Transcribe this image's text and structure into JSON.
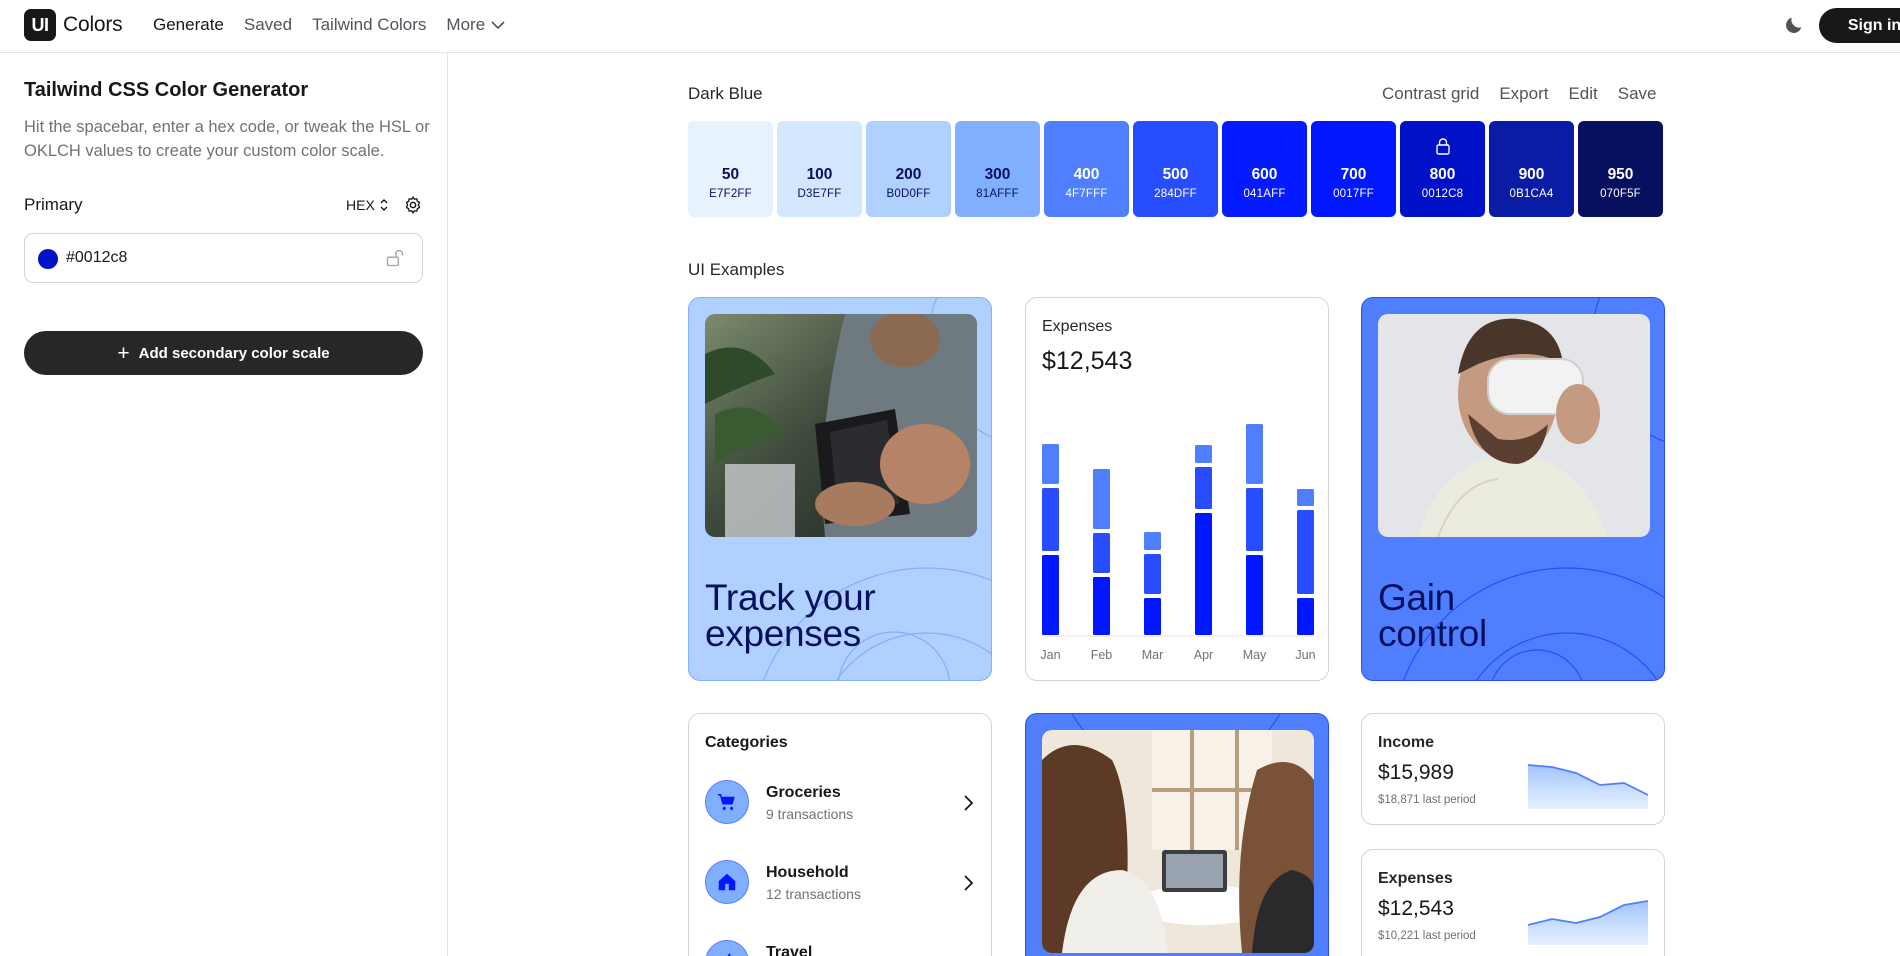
{
  "nav": {
    "logo_mark": "UI",
    "logo_text": "Colors",
    "links": [
      "Generate",
      "Saved",
      "Tailwind Colors"
    ],
    "more_label": "More",
    "signin_label": "Sign in"
  },
  "sidebar": {
    "title": "Tailwind CSS Color Generator",
    "description": "Hit the spacebar, enter a hex code, or tweak the HSL or OKLCH values to create your custom color scale.",
    "primary_label": "Primary",
    "format_label": "HEX",
    "input_value": "#0012c8",
    "input_color": "#0012c8",
    "add_button_label": "Add secondary color scale"
  },
  "palette": {
    "name": "Dark Blue",
    "actions": [
      "Contrast grid",
      "Export",
      "Edit",
      "Save"
    ],
    "locked_shade": "800",
    "swatches": [
      {
        "shade": "50",
        "hex": "E7F2FF",
        "color": "#e7f2ff",
        "text": "#070f5f"
      },
      {
        "shade": "100",
        "hex": "D3E7FF",
        "color": "#d3e7ff",
        "text": "#070f5f"
      },
      {
        "shade": "200",
        "hex": "B0D0FF",
        "color": "#b0d0ff",
        "text": "#070f5f"
      },
      {
        "shade": "300",
        "hex": "81AFFF",
        "color": "#81afff",
        "text": "#070f5f"
      },
      {
        "shade": "400",
        "hex": "4F7FFF",
        "color": "#4f7fff",
        "text": "#ffffff"
      },
      {
        "shade": "500",
        "hex": "284DFF",
        "color": "#284dff",
        "text": "#ffffff"
      },
      {
        "shade": "600",
        "hex": "041AFF",
        "color": "#041aff",
        "text": "#ffffff"
      },
      {
        "shade": "700",
        "hex": "0017FF",
        "color": "#0017ff",
        "text": "#ffffff"
      },
      {
        "shade": "800",
        "hex": "0012C8",
        "color": "#0012c8",
        "text": "#ffffff"
      },
      {
        "shade": "900",
        "hex": "0B1CA4",
        "color": "#0b1ca4",
        "text": "#ffffff"
      },
      {
        "shade": "950",
        "hex": "070F5F",
        "color": "#070f5f",
        "text": "#ffffff"
      }
    ]
  },
  "examples": {
    "heading": "UI Examples",
    "track_title_1": "Track your",
    "track_title_2": "expenses",
    "gain_title_1": "Gain",
    "gain_title_2": "control",
    "expenses_card": {
      "label": "Expenses",
      "amount": "$12,543"
    },
    "categories": {
      "title": "Categories",
      "items": [
        {
          "name": "Groceries",
          "sub": "9 transactions",
          "icon": "cart-icon"
        },
        {
          "name": "Household",
          "sub": "12 transactions",
          "icon": "home-icon"
        },
        {
          "name": "Travel",
          "sub": "",
          "icon": "plane-icon"
        }
      ]
    },
    "income_card": {
      "label": "Income",
      "amount": "$15,989",
      "sub": "$18,871 last period"
    },
    "expenses_mini": {
      "label": "Expenses",
      "amount": "$12,543",
      "sub": "$10,221 last period"
    }
  },
  "chart_data": {
    "type": "bar",
    "stacked": true,
    "categories": [
      "Jan",
      "Feb",
      "Mar",
      "Apr",
      "May",
      "Jun"
    ],
    "series": [
      {
        "values": [
          80,
          58,
          37,
          122,
          80,
          37
        ],
        "color": "#0017ff"
      },
      {
        "values": [
          63,
          40,
          40,
          42,
          63,
          84
        ],
        "color": "#284dff"
      },
      {
        "values": [
          40,
          60,
          18,
          18,
          60,
          17
        ],
        "color": "#4f7fff"
      }
    ]
  },
  "sparklines": {
    "income": [
      10,
      12,
      18,
      30,
      28,
      40
    ],
    "expenses": [
      34,
      28,
      32,
      26,
      14,
      10
    ]
  }
}
